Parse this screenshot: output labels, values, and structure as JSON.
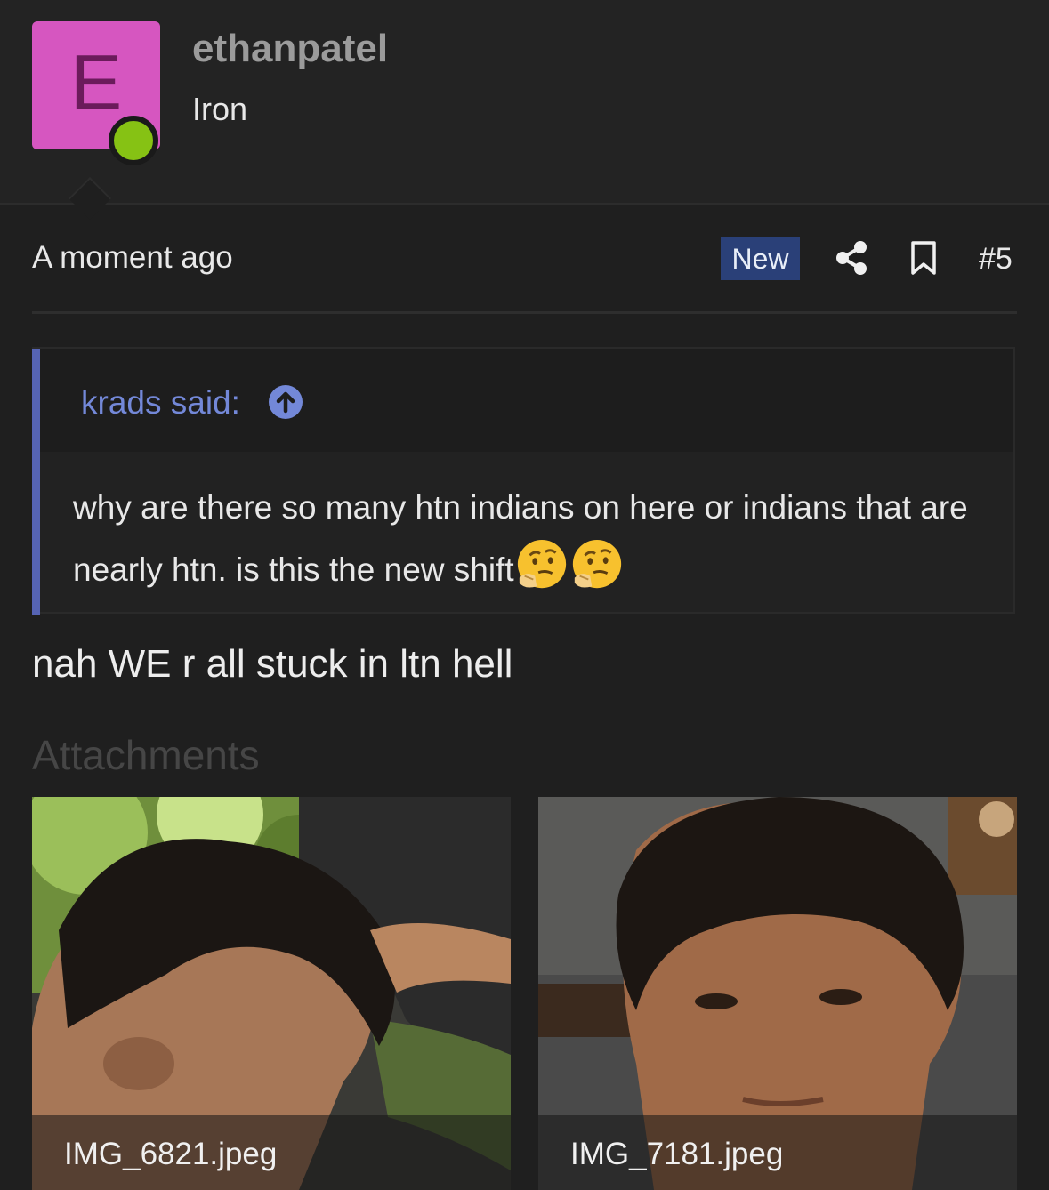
{
  "user": {
    "avatar_letter": "E",
    "avatar_color": "#d656c0",
    "online_color": "#86c214",
    "username": "ethanpatel",
    "rank": "Iron"
  },
  "post": {
    "time": "A moment ago",
    "badge": "New",
    "number": "#5",
    "share_icon": "share-icon",
    "bookmark_icon": "bookmark-icon"
  },
  "quote": {
    "author": "krads said:",
    "text": "why are there so many htn indians on here or indians that are nearly htn. is this the new shift",
    "emoji": "thinking-face-emoji"
  },
  "reply": "nah WE r all stuck in ltn hell",
  "attachments": {
    "title": "Attachments",
    "files": [
      {
        "name": "IMG_6821.jpeg"
      },
      {
        "name": "IMG_7181.jpeg"
      }
    ]
  },
  "colors": {
    "accent_quote": "#5664b4",
    "badge_bg": "#2a4078",
    "link": "#7388d8"
  }
}
